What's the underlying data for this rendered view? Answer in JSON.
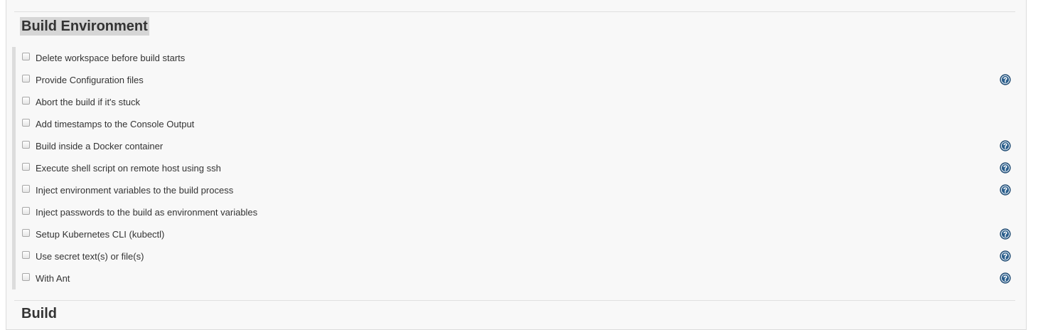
{
  "section": {
    "title": "Build Environment",
    "options": [
      {
        "label": "Delete workspace before build starts",
        "checked": false,
        "help": false
      },
      {
        "label": "Provide Configuration files",
        "checked": false,
        "help": true
      },
      {
        "label": "Abort the build if it's stuck",
        "checked": false,
        "help": false
      },
      {
        "label": "Add timestamps to the Console Output",
        "checked": false,
        "help": false
      },
      {
        "label": "Build inside a Docker container",
        "checked": false,
        "help": true
      },
      {
        "label": "Execute shell script on remote host using ssh",
        "checked": false,
        "help": true
      },
      {
        "label": "Inject environment variables to the build process",
        "checked": false,
        "help": true
      },
      {
        "label": "Inject passwords to the build as environment variables",
        "checked": false,
        "help": false
      },
      {
        "label": "Setup Kubernetes CLI (kubectl)",
        "checked": false,
        "help": true
      },
      {
        "label": "Use secret text(s) or file(s)",
        "checked": false,
        "help": true
      },
      {
        "label": "With Ant",
        "checked": false,
        "help": true
      }
    ]
  },
  "next_section": {
    "title": "Build"
  },
  "colors": {
    "help_icon": "#2a5e8c",
    "title_highlight": "#d6d6d6",
    "panel_bg": "#f8f8f8"
  },
  "icons": {
    "help": "question-circle-icon"
  }
}
